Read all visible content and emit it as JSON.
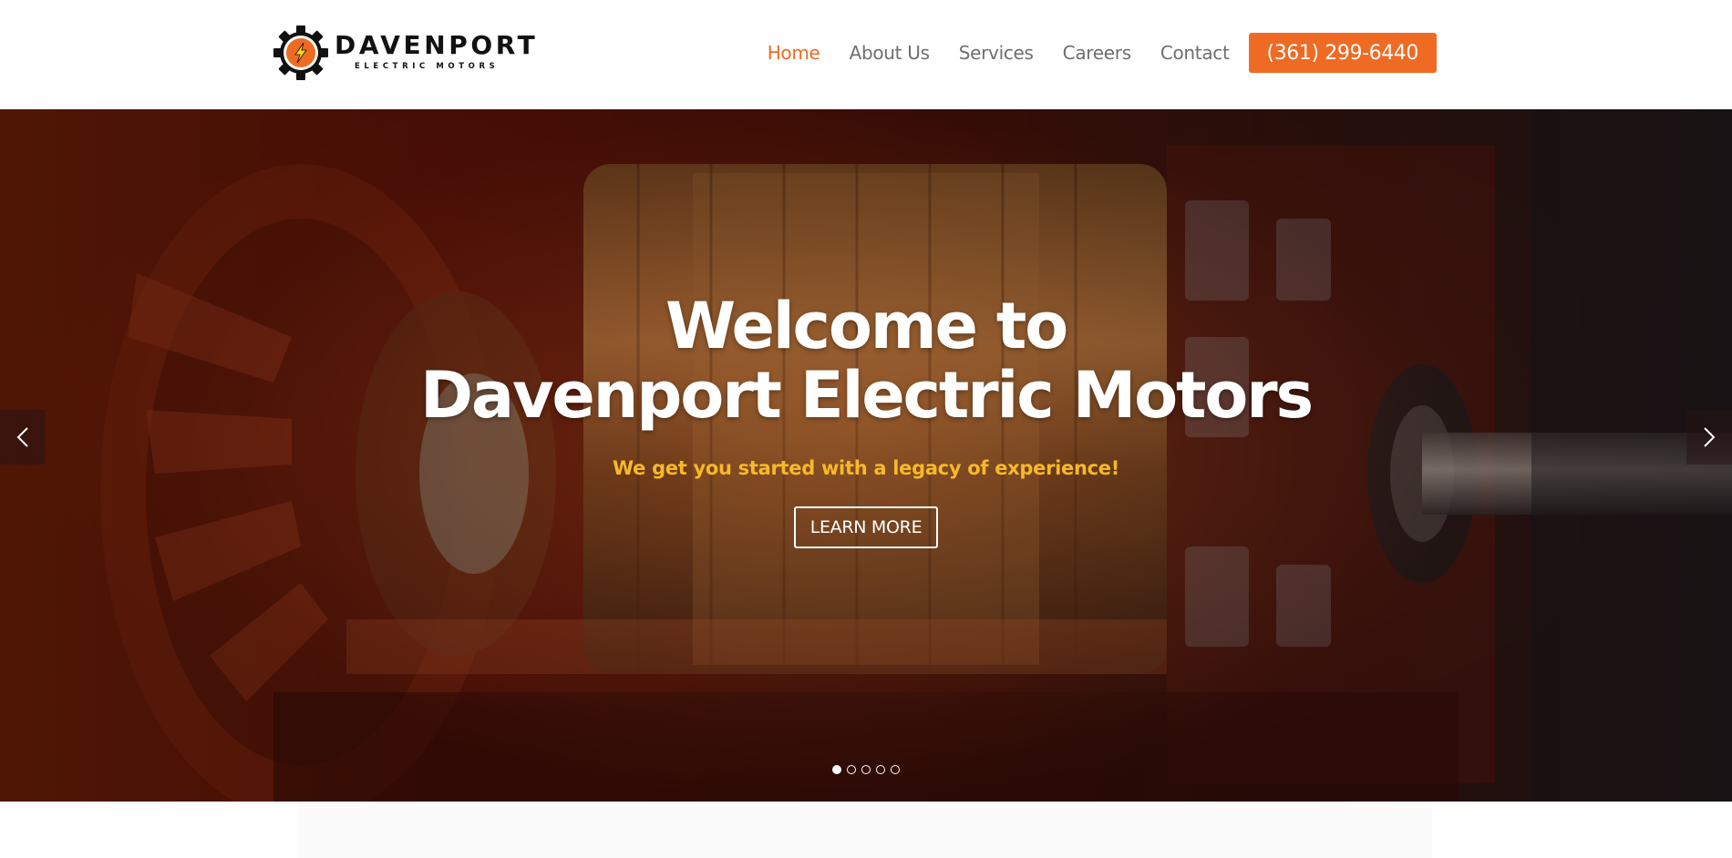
{
  "brand": {
    "name": "DAVENPORT",
    "tagline": "ELECTRIC MOTORS",
    "logo_icon": "gear-lightning-icon",
    "accent_color": "#ef6a23"
  },
  "nav": {
    "items": [
      {
        "label": "Home",
        "active": true
      },
      {
        "label": "About Us",
        "active": false
      },
      {
        "label": "Services",
        "active": false
      },
      {
        "label": "Careers",
        "active": false
      },
      {
        "label": "Contact",
        "active": false
      }
    ],
    "phone": "(361) 299-6440"
  },
  "hero": {
    "title_line1": "Welcome to",
    "title_line2": "Davenport Electric Motors",
    "subtitle": "We get you started with a legacy of experience!",
    "cta_label": "LEARN MORE",
    "subtitle_color": "#f7b928",
    "prev_icon": "chevron-left-icon",
    "next_icon": "chevron-right-icon",
    "slides": {
      "count": 5,
      "active": 1
    }
  }
}
